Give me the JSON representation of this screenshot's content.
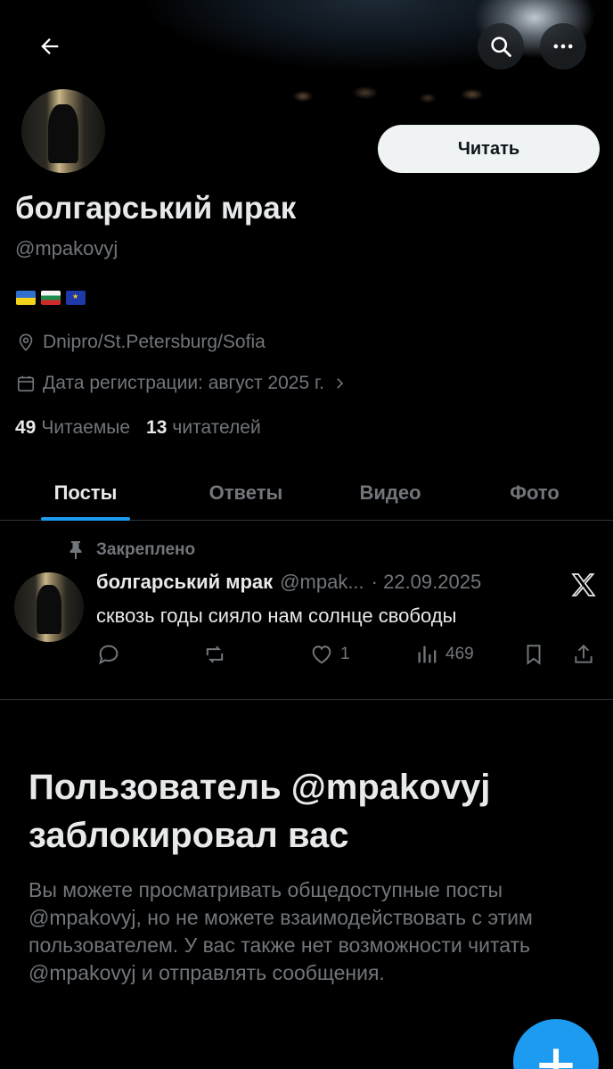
{
  "profile": {
    "display_name": "болгарський мрак",
    "handle": "@mpakovyj",
    "follow_button": "Читать",
    "location": "Dnipro/St.Petersburg/Sofia",
    "joined": "Дата регистрации: август 2025 г.",
    "following_count": "49",
    "following_label": "Читаемые",
    "followers_count": "13",
    "followers_label": "читателей",
    "flags": [
      "ukraine-flag",
      "bulgaria-flag",
      "eu-flag"
    ]
  },
  "tabs": [
    {
      "label": "Посты"
    },
    {
      "label": "Ответы"
    },
    {
      "label": "Видео"
    },
    {
      "label": "Фото"
    }
  ],
  "pinned_post": {
    "pinned_label": "Закреплено",
    "author_name": "болгарський мрак",
    "author_handle": "@mpak...",
    "date": "· 22.09.2025",
    "text": "сквозь годы сияло нам солнце свободы",
    "likes": "1",
    "views": "469"
  },
  "blocked": {
    "title": "Пользователь @mpakovyj заблокировал вас",
    "body": "Вы можете просматривать общедоступные посты @mpakovyj, но не можете взаимодействовать с этим пользователем. У вас также нет возможности читать @mpakovyj и отправлять сообщения."
  },
  "colors": {
    "accent": "#1d9bf0",
    "muted": "#71767b",
    "text": "#e7e9ea",
    "background": "#000000"
  }
}
